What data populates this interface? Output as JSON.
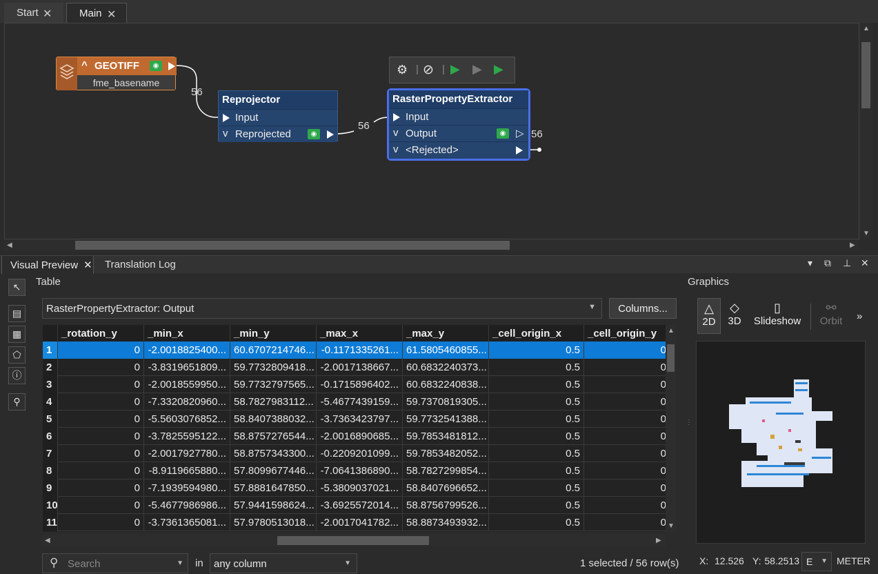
{
  "tabs": [
    {
      "label": "Start"
    },
    {
      "label": "Main"
    }
  ],
  "canvas": {
    "geotiff": {
      "title": "GEOTIFF",
      "attribute": "fme_basename",
      "count": "56"
    },
    "reprojector": {
      "title": "Reprojector",
      "input": "Input",
      "output": "Reprojected",
      "count": "56"
    },
    "rpe": {
      "title": "RasterPropertyExtractor",
      "input": "Input",
      "output": "Output",
      "rejected": "<Rejected>",
      "count": "56"
    }
  },
  "panel": {
    "tabs": [
      {
        "label": "Visual Preview"
      },
      {
        "label": "Translation Log"
      }
    ]
  },
  "table_section": {
    "label": "Table",
    "source": "RasterPropertyExtractor: Output",
    "columns_button": "Columns...",
    "headers": [
      "",
      "_rotation_y",
      "_min_x",
      "_min_y",
      "_max_x",
      "_max_y",
      "_cell_origin_x",
      "_cell_origin_y"
    ],
    "rows": [
      [
        "1",
        "0",
        "-2.0018825400...",
        "60.6707214746...",
        "-0.1171335261...",
        "61.5805460855...",
        "0.5",
        "0"
      ],
      [
        "2",
        "0",
        "-3.8319651809...",
        "59.7732809418...",
        "-2.0017138667...",
        "60.6832240373...",
        "0.5",
        "0"
      ],
      [
        "3",
        "0",
        "-2.0018559950...",
        "59.7732797565...",
        "-0.1715896402...",
        "60.6832240838...",
        "0.5",
        "0"
      ],
      [
        "4",
        "0",
        "-7.3320820960...",
        "58.7827983112...",
        "-5.4677439159...",
        "59.7370819305...",
        "0.5",
        "0"
      ],
      [
        "5",
        "0",
        "-5.5603076852...",
        "58.8407388032...",
        "-3.7363423797...",
        "59.7732541388...",
        "0.5",
        "0"
      ],
      [
        "6",
        "0",
        "-3.7825595122...",
        "58.8757276544...",
        "-2.0016890685...",
        "59.7853481812...",
        "0.5",
        "0"
      ],
      [
        "7",
        "0",
        "-2.0017927780...",
        "58.8757343300...",
        "-0.2209201099...",
        "59.7853482052...",
        "0.5",
        "0"
      ],
      [
        "8",
        "0",
        "-8.9119665880...",
        "57.8099677446...",
        "-7.0641386890...",
        "58.7827299854...",
        "0.5",
        "0"
      ],
      [
        "9",
        "0",
        "-7.1939594980...",
        "57.8881647850...",
        "-5.3809037021...",
        "58.8407696652...",
        "0.5",
        "0"
      ],
      [
        "10",
        "0",
        "-5.4677986986...",
        "57.9441598624...",
        "-3.6925572014...",
        "58.8756799526...",
        "0.5",
        "0"
      ],
      [
        "11",
        "0",
        "-3.7361365081...",
        "57.9780513018...",
        "-2.0017041782...",
        "58.8873493932...",
        "0.5",
        "0"
      ]
    ],
    "search_placeholder": "Search",
    "in_label": "in",
    "column_filter": "any column",
    "status": "1 selected / 56 row(s)"
  },
  "graphics": {
    "label": "Graphics",
    "tools": [
      {
        "label": "2D"
      },
      {
        "label": "3D"
      },
      {
        "label": "Slideshow"
      },
      {
        "label": "Orbit"
      }
    ],
    "coords": {
      "x_label": "X:",
      "x_value": "12.526",
      "y_label": "Y:",
      "y_value": "58.2513",
      "unit_short": "E",
      "unit": "METER"
    }
  }
}
